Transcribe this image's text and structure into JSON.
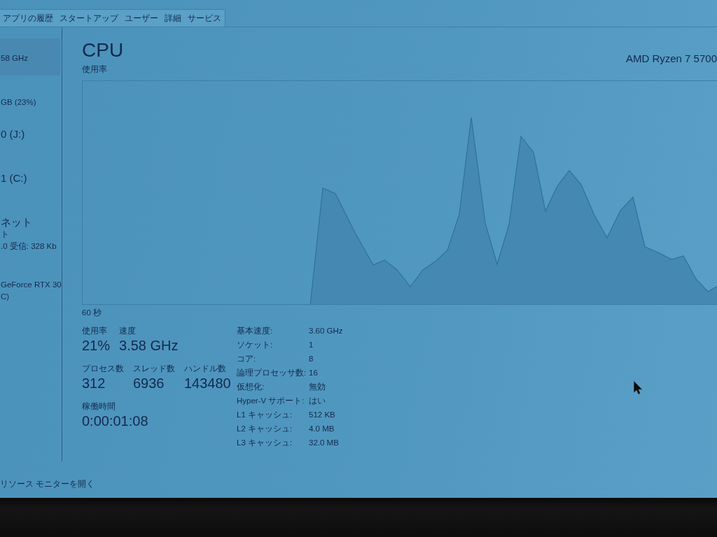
{
  "tabs": [
    {
      "label": "アプリの履歴",
      "selected": false
    },
    {
      "label": "スタートアップ",
      "selected": false
    },
    {
      "label": "ユーザー",
      "selected": false
    },
    {
      "label": "詳細",
      "selected": false
    },
    {
      "label": "サービス",
      "selected": false
    }
  ],
  "sidebar": {
    "items": [
      {
        "selected": true,
        "details": [
          "58 GHz"
        ]
      },
      {
        "selected": false,
        "details": [
          "GB (23%)"
        ]
      },
      {
        "selected": false,
        "title": "0 (J:)"
      },
      {
        "selected": false,
        "title": "1 (C:)"
      },
      {
        "selected": false,
        "title": "ネット",
        "details": [
          "ト",
          ".0 受信: 328 Kb"
        ]
      },
      {
        "selected": false,
        "details": [
          "GeForce RTX 30",
          "C)"
        ]
      }
    ]
  },
  "panel": {
    "title": "CPU",
    "processor": "AMD Ryzen 7 5700",
    "graph": {
      "label": "使用率",
      "time_span": "60 秒"
    },
    "stats": [
      [
        {
          "label": "使用率",
          "value": "21%"
        },
        {
          "label": "速度",
          "value": "3.58 GHz"
        }
      ],
      [
        {
          "label": "プロセス数",
          "value": "312"
        },
        {
          "label": "スレッド数",
          "value": "6936"
        },
        {
          "label": "ハンドル数",
          "value": "143480"
        }
      ],
      [
        {
          "label": "稼働時間",
          "value": "0:00:01:08"
        }
      ]
    ],
    "details": [
      {
        "label": "基本速度:",
        "value": "3.60 GHz"
      },
      {
        "label": "ソケット:",
        "value": "1"
      },
      {
        "label": "コア:",
        "value": "8"
      },
      {
        "label": "論理プロセッサ数:",
        "value": "16"
      },
      {
        "label": "仮想化:",
        "value": "無効"
      },
      {
        "label": "Hyper-V サポート:",
        "value": "はい"
      },
      {
        "label": "L1 キャッシュ:",
        "value": "512 KB"
      },
      {
        "label": "L2 キャッシュ:",
        "value": "4.0 MB"
      },
      {
        "label": "L3 キャッシュ:",
        "value": "32.0 MB"
      }
    ]
  },
  "footer": {
    "link": "リソース モニターを開く"
  }
}
